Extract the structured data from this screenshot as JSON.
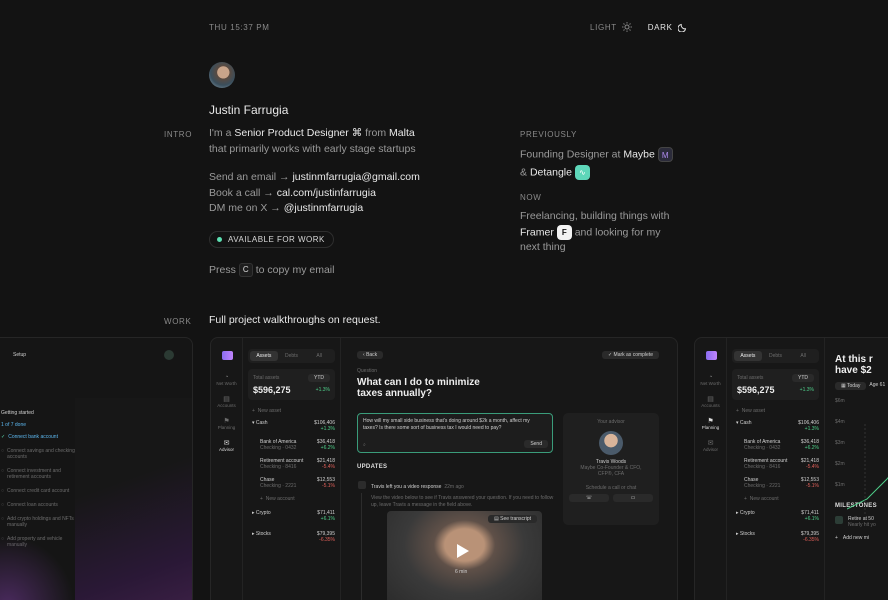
{
  "header": {
    "clock": "THU 15:37 PM",
    "light_label": "LIGHT",
    "dark_label": "DARK"
  },
  "profile": {
    "name": "Justin Farrugia"
  },
  "intro": {
    "section_label": "INTRO",
    "line1_prefix": "I'm a",
    "role": "Senior Product Designer",
    "role_icon": "⌘",
    "line1_mid": "from",
    "location": "Malta",
    "line2": "that primarily works with early stage startups",
    "email_prefix": "Send an email →",
    "email": "justinmfarrugia@gmail.com",
    "call_prefix": "Book a call →",
    "call": "cal.com/justinfarrugia",
    "dm_prefix": "DM me on X →",
    "handle": "@justinmfarrugia",
    "availability": "AVAILABLE FOR WORK",
    "copy_prefix": "Press",
    "copy_key": "C",
    "copy_suffix": "to copy my email"
  },
  "previously": {
    "label": "PREVIOUSLY",
    "text_prefix": "Founding Designer at",
    "company1": "Maybe",
    "amp": "&",
    "company2": "Detangle"
  },
  "now": {
    "label": "NOW",
    "line1": "Freelancing, building things with",
    "company": "Framer",
    "line2_suffix": "and looking for my",
    "line3": "next thing"
  },
  "work": {
    "section_label": "WORK",
    "text": "Full project walkthroughs on request."
  },
  "card_left": {
    "setup": "Setup",
    "getting_started": "Getting started",
    "progress": "1 of 7 done",
    "steps": [
      "Connect bank account",
      "Connect savings and checking accounts",
      "Connect investment and retirement accounts",
      "Connect credit card account",
      "Connect loan accounts",
      "Add crypto holdings and NFTs manually",
      "Add property and vehicle manually"
    ]
  },
  "card_mid": {
    "tabs": [
      "Assets",
      "Debts",
      "All"
    ],
    "total_label": "Total assets",
    "total_value": "$596,275",
    "ytd": "YTD",
    "change": "+1.3%",
    "nav": [
      "Net Worth",
      "Accounts",
      "Planning",
      "Advisor"
    ],
    "new_asset": "New asset",
    "accounts": [
      {
        "name": "Cash",
        "value": "$106,406",
        "delta": "+1.3%",
        "sub": "",
        "up": true
      },
      {
        "name": "Bank of America",
        "value": "$36,418",
        "delta": "+6.2%",
        "sub": "Checking · 0432",
        "up": true
      },
      {
        "name": "Retirement account",
        "value": "$21,418",
        "delta": "-5.4%",
        "sub": "Checking · 8416",
        "up": false
      },
      {
        "name": "Chase",
        "value": "$12,553",
        "delta": "-5.1%",
        "sub": "Checking · 2221",
        "up": false
      }
    ],
    "new_account": "New account",
    "groups": [
      {
        "name": "Crypto",
        "value": "$71,411",
        "delta": "+6.1%",
        "up": true
      },
      {
        "name": "Stocks",
        "value": "$79,395",
        "delta": "-6.35%",
        "up": false
      }
    ],
    "back": "Back",
    "mark_complete": "Mark as complete",
    "question_label": "Question",
    "question_title": "What can I do to minimize taxes annually?",
    "question_body": "How will my small side business that's doing around $2k a month, affect my taxes? Is there some sort of business tax I would need to pay?",
    "send": "Send",
    "advisor_label": "Your advisor",
    "advisor_name": "Travis Woods",
    "advisor_role1": "Maybe Co-Founder & CFO,",
    "advisor_role2": "CFP®, CFA",
    "schedule": "Schedule a call or chat",
    "updates": "UPDATES",
    "update_title": "Travis left you a video response",
    "update_time": "22m ago",
    "update_body": "View the video below to see if Travis answered your question. If you need to follow up, leave Travis a message in the field above.",
    "transcript": "See transcript",
    "duration": "6 min"
  },
  "card_right": {
    "headline1": "At this r",
    "headline2": "have $2",
    "today": "Today",
    "age": "Age 61",
    "yaxis": [
      "$6m",
      "$4m",
      "$3m",
      "$2m",
      "$1m"
    ],
    "milestones": "MILESTONES",
    "milestone1": "Retire at 50",
    "milestone1_sub": "Nearly hit yo",
    "add_milestone": "Add new mi"
  },
  "colors": {
    "background": "#131313",
    "accent_green": "#5de0b2",
    "maybe_purple": "#7b5bd6",
    "detangle_teal": "#5ed6b9"
  }
}
